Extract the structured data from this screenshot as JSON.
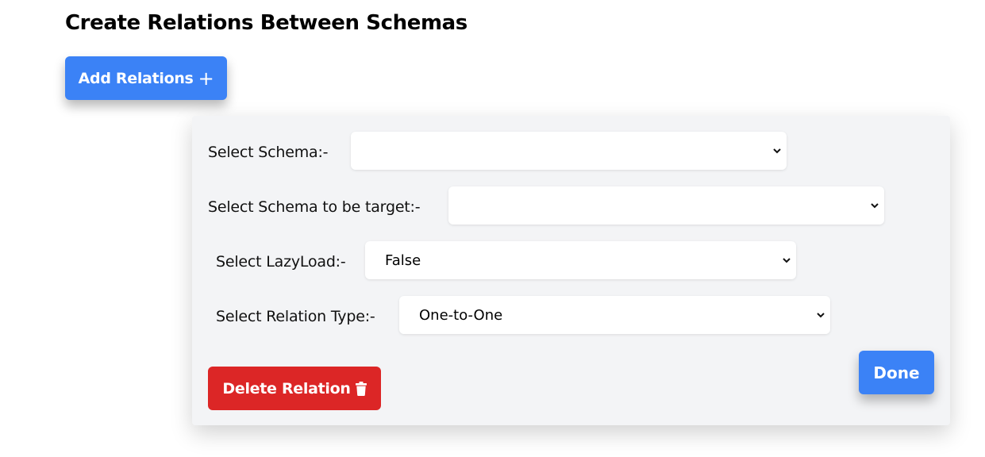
{
  "page": {
    "title": "Create Relations Between Schemas"
  },
  "toolbar": {
    "add_label": "Add Relations",
    "add_icon": "plus-icon"
  },
  "form": {
    "schema": {
      "label": "Select Schema:-",
      "value": ""
    },
    "target": {
      "label": "Select Schema to be target:-",
      "value": ""
    },
    "lazyload": {
      "label": "Select LazyLoad:-",
      "value": "False"
    },
    "relation_type": {
      "label": "Select Relation Type:-",
      "value": "One-to-One"
    }
  },
  "actions": {
    "delete_label": "Delete Relation",
    "delete_icon": "trash-icon",
    "done_label": "Done"
  },
  "colors": {
    "primary": "#3b82f6",
    "danger": "#dc2626",
    "panel_bg": "#f3f4f6"
  }
}
